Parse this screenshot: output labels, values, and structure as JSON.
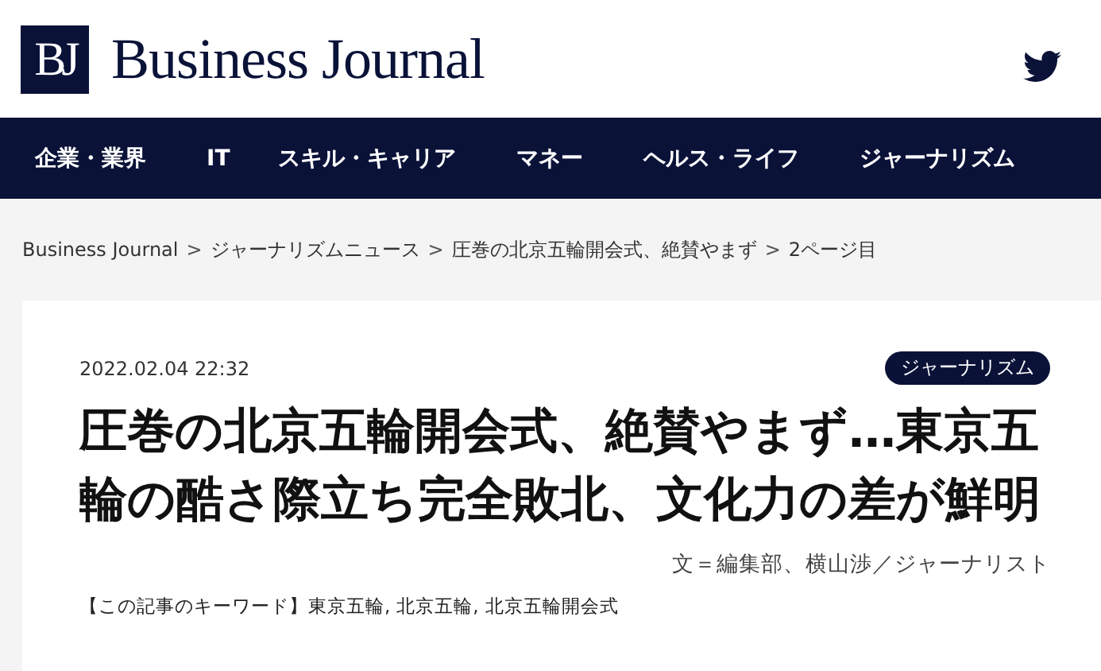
{
  "header": {
    "logo_mark": "BJ",
    "logo_text": "Business Journal"
  },
  "nav": [
    {
      "label": "企業・業界"
    },
    {
      "label": "IT"
    },
    {
      "label": "スキル・キャリア"
    },
    {
      "label": "マネー"
    },
    {
      "label": "ヘルス・ライフ"
    },
    {
      "label": "ジャーナリズム"
    }
  ],
  "breadcrumb_separator": ">",
  "breadcrumb": [
    "Business Journal",
    "ジャーナリズムニュース",
    "圧巻の北京五輪開会式、絶賛やまず",
    "2ページ目"
  ],
  "article": {
    "date": "2022.02.04 22:32",
    "category": "ジャーナリズム",
    "title": "圧巻の北京五輪開会式、絶賛やまず…東京五輪の酷さ際立ち完全敗北、文化力の差が鮮明",
    "byline": "文＝編集部、横山渉／ジャーナリスト",
    "keywords_label": "【この記事のキーワード】",
    "keyword_separator": ",",
    "keywords": [
      "東京五輪",
      "北京五輪",
      "北京五輪開会式"
    ]
  }
}
